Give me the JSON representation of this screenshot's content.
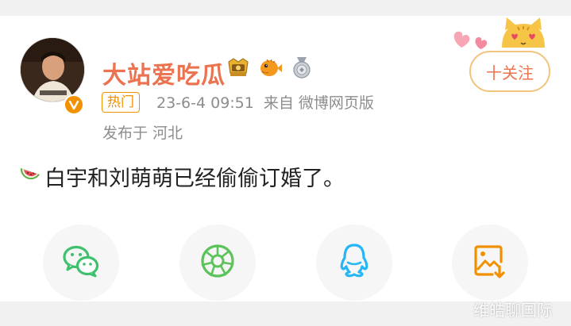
{
  "post": {
    "author": {
      "name": "大站爱吃瓜",
      "verified_icon": "orange-verified-icon"
    },
    "badges": [
      "golden-trophy-badge-icon",
      "pufferfish-badge-icon",
      "silver-medal-badge-icon"
    ],
    "hot_tag": "热门",
    "timestamp": "23-6-4 09:51",
    "source": "来自 微博网页版",
    "location": "发布于 河北",
    "follow_label": "十关注",
    "content_emoji": "watermelon-icon",
    "content_text": "白宇和刘萌萌已经偷偷订婚了。"
  },
  "share": {
    "items": [
      {
        "icon": "wechat-icon"
      },
      {
        "icon": "moments-icon"
      },
      {
        "icon": "qq-icon"
      },
      {
        "icon": "save-image-icon"
      }
    ]
  },
  "watermark": "维皓聊国际",
  "colors": {
    "accent": "#eb7350",
    "hot": "#f29100",
    "wechat": "#3ec06c",
    "moments": "#5cc25a",
    "qq": "#25b6f6",
    "save": "#f29100",
    "meta_gray": "#8d8d8d"
  }
}
